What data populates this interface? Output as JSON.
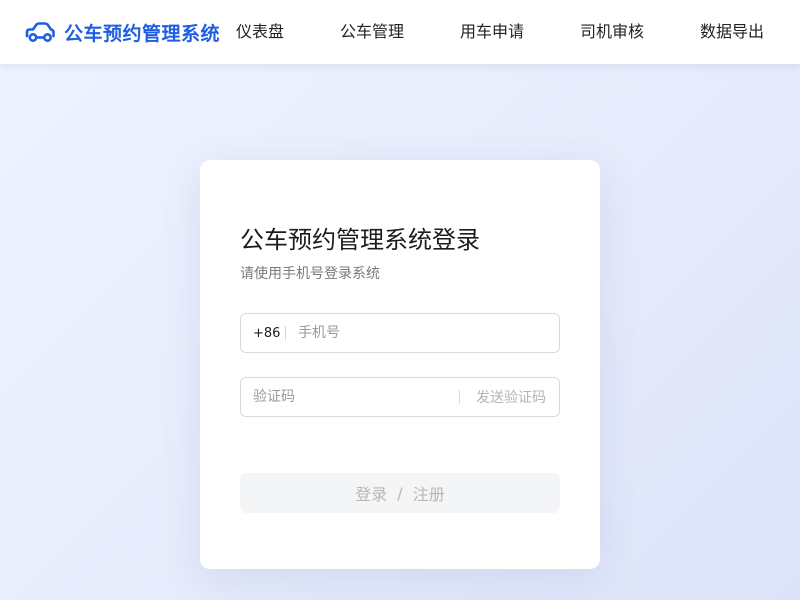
{
  "header": {
    "brand_title": "公车预约管理系统",
    "logo_icon": "car-icon",
    "brand_color": "#1f5ee0",
    "nav": [
      {
        "label": "仪表盘"
      },
      {
        "label": "公车管理"
      },
      {
        "label": "用车申请"
      },
      {
        "label": "司机审核"
      },
      {
        "label": "数据导出"
      }
    ]
  },
  "login": {
    "title": "公车预约管理系统登录",
    "subtitle": "请使用手机号登录系统",
    "phone": {
      "prefix": "+86",
      "placeholder": "手机号",
      "value": ""
    },
    "code": {
      "placeholder": "验证码",
      "value": "",
      "send_label": "发送验证码"
    },
    "submit": {
      "login_label": "登录",
      "separator": "/",
      "register_label": "注册"
    }
  }
}
